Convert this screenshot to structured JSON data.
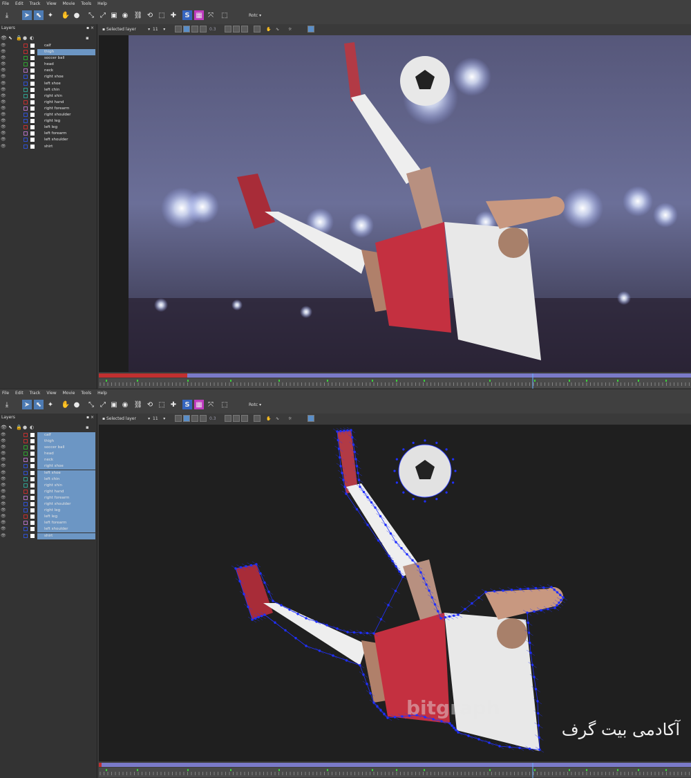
{
  "menu": [
    "File",
    "Edit",
    "Track",
    "View",
    "Movie",
    "Tools",
    "Help"
  ],
  "toolbar": {
    "dropdown_label": "Rotc"
  },
  "subtoolbar": {
    "layer_select": "Selected layer",
    "size_value": "11",
    "zoom_value": "0.3"
  },
  "layers_panel": {
    "title": "Layers",
    "items": [
      {
        "label": "calf",
        "color": "#c03030"
      },
      {
        "label": "thigh",
        "color": "#c03030"
      },
      {
        "label": "soccer ball",
        "color": "#30a030"
      },
      {
        "label": "head",
        "color": "#30a030"
      },
      {
        "label": "neck",
        "color": "#b070c0"
      },
      {
        "label": "right shoe",
        "color": "#3050d0"
      },
      {
        "label": "left shoe",
        "color": "#3050d0"
      },
      {
        "label": "left chin",
        "color": "#30a090"
      },
      {
        "label": "right shin",
        "color": "#30a090"
      },
      {
        "label": "right hand",
        "color": "#c03030"
      },
      {
        "label": "right forearm",
        "color": "#b070c0"
      },
      {
        "label": "right shoulder",
        "color": "#3050d0"
      },
      {
        "label": "right leg",
        "color": "#3050d0"
      },
      {
        "label": "left leg",
        "color": "#c03030"
      },
      {
        "label": "left forearm",
        "color": "#b070c0"
      },
      {
        "label": "left shoulder",
        "color": "#3050d0"
      },
      {
        "label": "shirt",
        "color": "#3050d0"
      }
    ]
  },
  "watermarks": {
    "latin": "bitgraph",
    "persian": "آکادمی بیت گرف"
  },
  "colors": {
    "accent": "#4d7bb3",
    "selection": "#6c96c4",
    "timeline_bar": "#7a7ac8",
    "tracking_points": "#2030ff"
  }
}
